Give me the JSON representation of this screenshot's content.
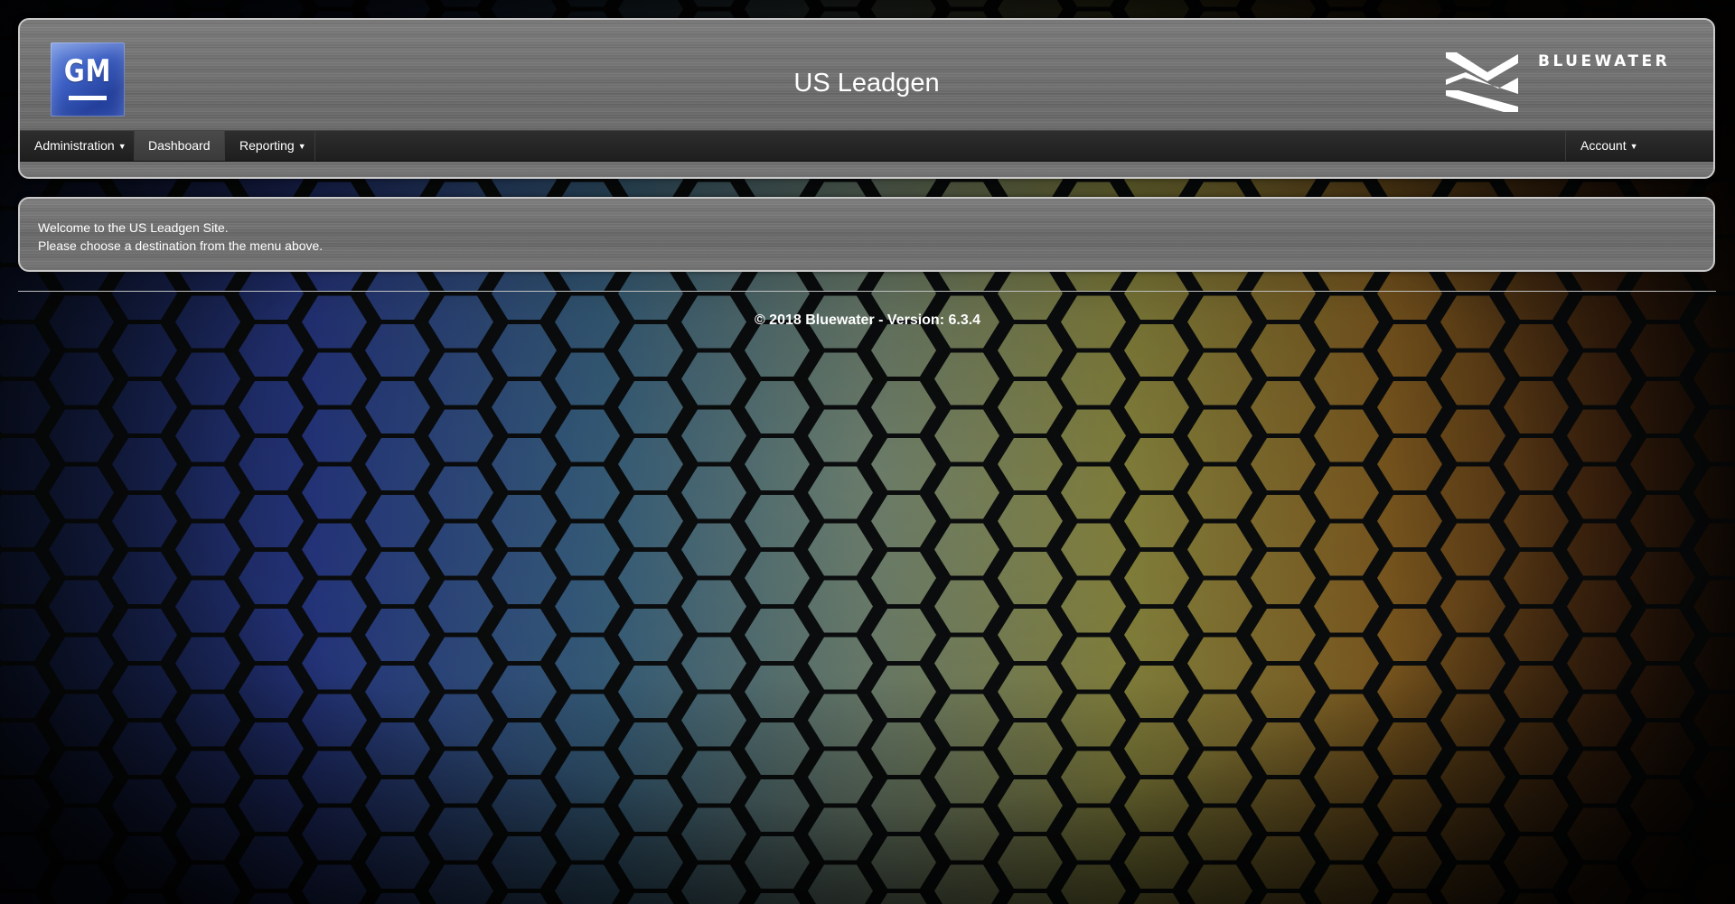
{
  "header": {
    "title": "US Leadgen",
    "left_logo": {
      "text": "GM",
      "color": "#3c5fc4"
    },
    "right_logo": {
      "text": "BLUEWATER"
    }
  },
  "nav": {
    "administration": "Administration",
    "dashboard": "Dashboard",
    "reporting": "Reporting",
    "account": "Account",
    "caret": "▼"
  },
  "welcome": {
    "line1": "Welcome to the US Leadgen Site.",
    "line2": "Please choose a destination from the menu above."
  },
  "footer": {
    "text": "© 2018 Bluewater - Version: 6.3.4"
  },
  "theme": {
    "panel_border": "#c9c9c9",
    "nav_bg": "#262626",
    "hex_colors": [
      "#2b3a8c",
      "#3f6f86",
      "#8a8a4a",
      "#8a6a24",
      "#5a2e12"
    ]
  }
}
